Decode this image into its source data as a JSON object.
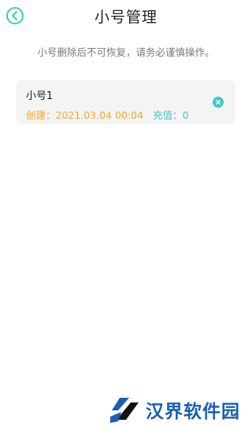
{
  "header": {
    "title": "小号管理",
    "back_icon": "chevron-left-circle-icon"
  },
  "notice": "小号删除后不可恢复，请务必谨慎操作。",
  "accounts": [
    {
      "name": "小号1",
      "created": "创建：2021.03.04 00:04",
      "recharge": "充值：0",
      "delete_icon": "close-circle-icon"
    }
  ],
  "watermark": {
    "text": "汉界软件园"
  },
  "colors": {
    "accent": "#3ec9c2",
    "created_text": "#f0a736",
    "card_bg": "#f4f4f4",
    "watermark": "#1a5fb4"
  }
}
